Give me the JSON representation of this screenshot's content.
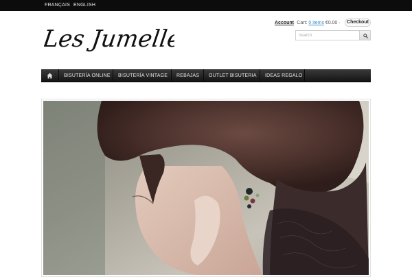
{
  "languages": [
    "FRANÇAIS",
    "ENGLISH"
  ],
  "logo": {
    "text": "Les Jumelles"
  },
  "header": {
    "account_label": "Account",
    "cart_prefix": "· Cart:",
    "cart_items": "0 items",
    "cart_total": "€0.00 ·",
    "checkout_label": "Checkout"
  },
  "search": {
    "placeholder": "Search"
  },
  "nav": {
    "items": [
      {
        "label": "BISUTERÍA ONLINE"
      },
      {
        "label": "BISUTERÍA VINTAGE"
      },
      {
        "label": "REBAJAS"
      },
      {
        "label": "OUTLET BISUTERIA"
      },
      {
        "label": "IDEAS REGALO"
      }
    ]
  },
  "colors": {
    "topbar": "#0c0c0c",
    "nav": "#1e1e1e",
    "link": "#3a8fc7"
  },
  "icons": {
    "home": "home-icon",
    "search": "search-icon"
  }
}
